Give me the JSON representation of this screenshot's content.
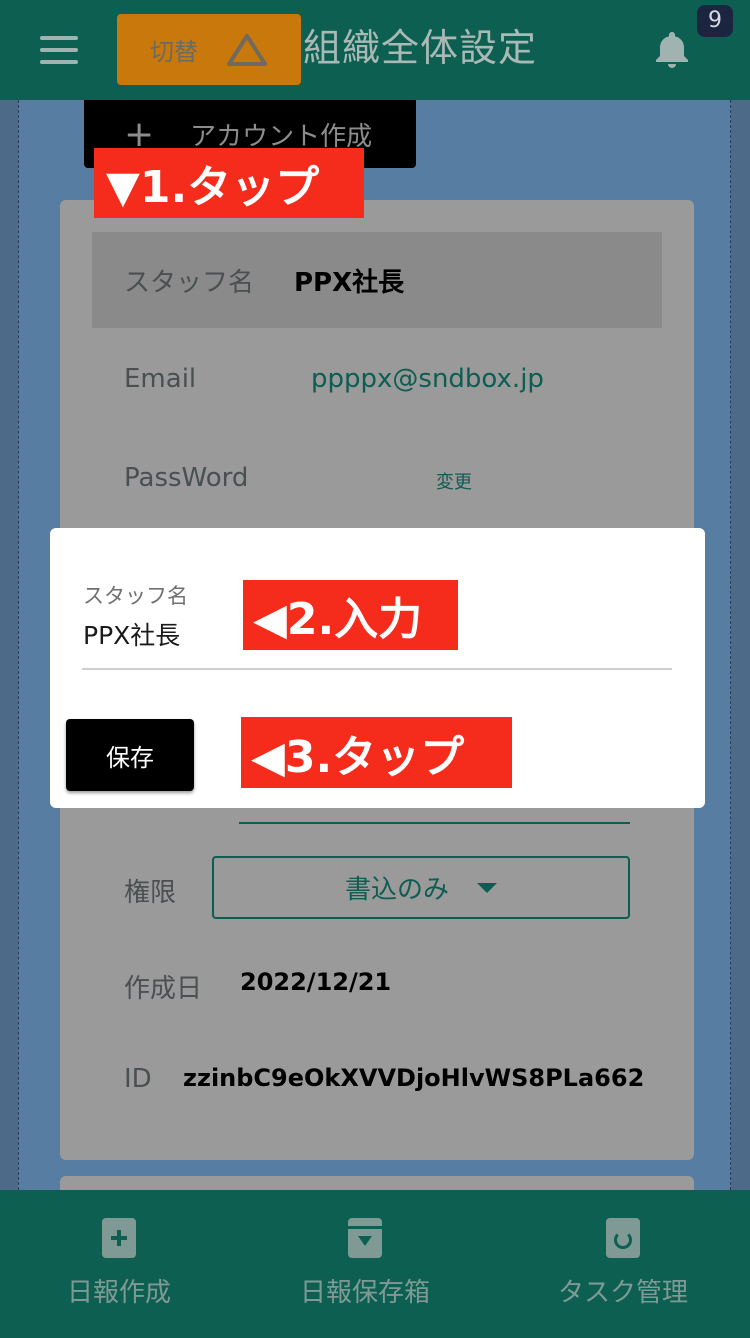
{
  "header": {
    "switch_label": "切替",
    "title": "組織全体設定",
    "notification_count": "9"
  },
  "toolbar": {
    "create_account_label": "アカウント作成"
  },
  "annotations": {
    "step1": "▼1.タップ",
    "step2": "◀2.入力",
    "step3": "◀3.タップ"
  },
  "card": {
    "staff_label": "スタッフ名",
    "staff_value": "PPX社長",
    "email_label": "Email",
    "email_value": "ppppx@sndbox.jp",
    "password_label": "PassWord",
    "password_change": "変更",
    "role_label": "権限",
    "role_value": "書込のみ",
    "created_label": "作成日",
    "created_value": "2022/12/21",
    "id_label": "ID",
    "id_value": "zzinbC9eOkXVVDjoHlvWS8PLa662"
  },
  "modal": {
    "field_label": "スタッフ名",
    "field_value": "PPX社長",
    "save_label": "保存"
  },
  "bottom_nav": {
    "items": [
      {
        "label": "日報作成",
        "icon": "file-plus-icon"
      },
      {
        "label": "日報保存箱",
        "icon": "archive-icon"
      },
      {
        "label": "タスク管理",
        "icon": "file-refresh-icon"
      }
    ]
  }
}
